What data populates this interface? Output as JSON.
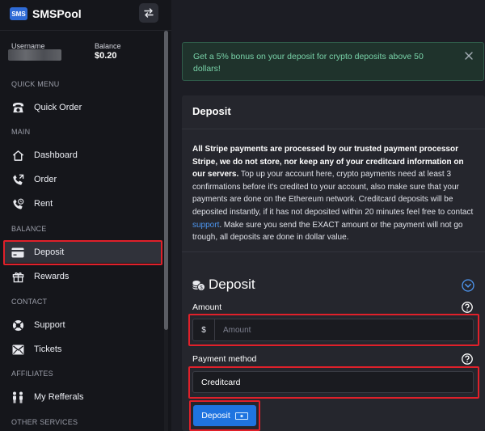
{
  "brand": {
    "badge": "SMS",
    "name": "SMSPool"
  },
  "user": {
    "username_label": "Username",
    "balance_label": "Balance",
    "balance_value": "$0.20"
  },
  "sidebar": {
    "sections": [
      "QUICK MENU",
      "MAIN",
      "BALANCE",
      "CONTACT",
      "AFFILIATES",
      "OTHER SERVICES"
    ],
    "items": [
      {
        "label": "Quick Order",
        "icon": "phone-icon"
      },
      {
        "label": "Dashboard",
        "icon": "home-icon"
      },
      {
        "label": "Order",
        "icon": "phone-forward-icon"
      },
      {
        "label": "Rent",
        "icon": "phone-clock-icon"
      },
      {
        "label": "Deposit",
        "icon": "credit-card-icon",
        "active": true
      },
      {
        "label": "Rewards",
        "icon": "gift-icon"
      },
      {
        "label": "Support",
        "icon": "lifebuoy-icon"
      },
      {
        "label": "Tickets",
        "icon": "ticket-icon"
      },
      {
        "label": "My Refferals",
        "icon": "users-icon"
      }
    ]
  },
  "alert": {
    "text": "Get a 5% bonus on your deposit for crypto deposits above 50 dollars!"
  },
  "card": {
    "title": "Deposit",
    "info_bold": "All Stripe payments are processed by our trusted payment processor Stripe, we do not store, nor keep any of your creditcard information on our servers.",
    "info_part1": " Top up your account here, crypto payments need at least 3 confirmations before it's credited to your account, also make sure that your payments are done on the Ethereum network. Creditcard deposits will be deposited instantly, if it has not deposited within 20 minutes feel free to contact ",
    "info_link": "support",
    "info_part2": ". Make sure you send the EXACT amount or the payment will not go trough, all deposits are done in dollar value."
  },
  "form": {
    "title": "Deposit",
    "amount_label": "Amount",
    "currency_prefix": "$",
    "amount_placeholder": "Amount",
    "payment_label": "Payment method",
    "payment_value": "Creditcard",
    "submit_label": "Deposit"
  },
  "colors": {
    "accent": "#1f74e0",
    "highlight": "#e0202a",
    "alert_text": "#78d2a8",
    "link": "#4d96f0"
  }
}
